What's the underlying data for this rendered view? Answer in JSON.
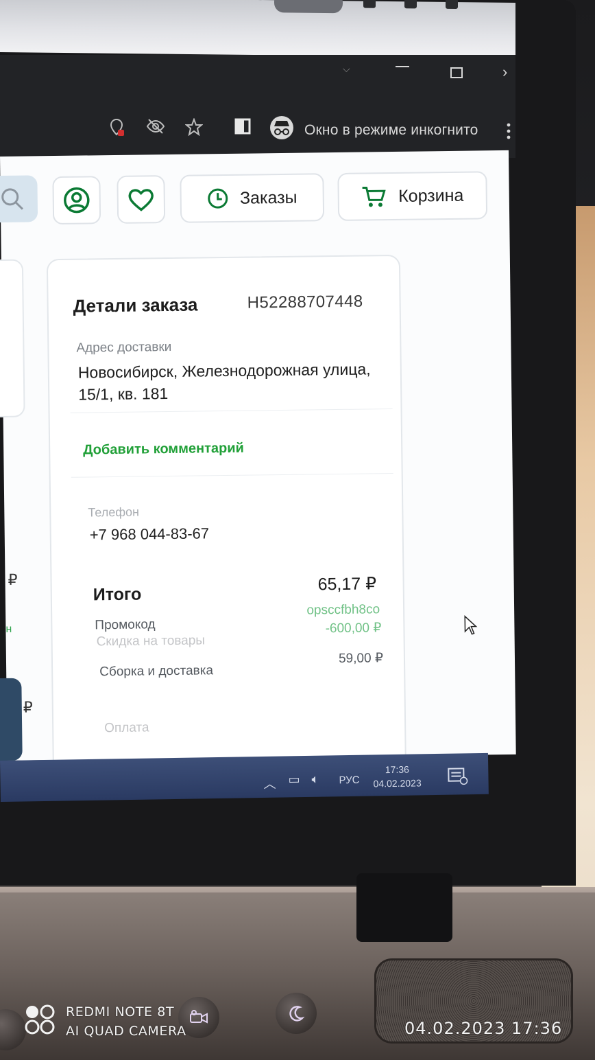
{
  "browser": {
    "incognito_label": "Окно в режиме инкогнито"
  },
  "header": {
    "orders_label": "Заказы",
    "cart_label": "Корзина"
  },
  "order": {
    "title": "Детали заказа",
    "number": "H52288707448",
    "address_label": "Адрес доставки",
    "address": "Новосибирск, Железнодорожная улица, 15/1, кв. 181",
    "add_comment_label": "Добавить комментарий",
    "phone_label": "Телефон",
    "phone": "+7 968 044-83-67",
    "total_label": "Итого",
    "total_value": "65,17 ₽",
    "promo_label": "Промокод",
    "promo_code": "opsccfbh8co",
    "discount_label": "Скидка на товары",
    "discount_value": "-600,00 ₽",
    "delivery_label": "Сборка и доставка",
    "delivery_value": "59,00 ₽",
    "payment_label": "Оплата"
  },
  "left_panel": {
    "currency_1": "₽",
    "green_fragment": "н",
    "currency_2": "₽"
  },
  "taskbar": {
    "language": "РУС",
    "time": "17:36",
    "date": "04.02.2023"
  },
  "camera_watermark": {
    "model": "REDMI NOTE 8T",
    "camera": "AI QUAD CAMERA",
    "datetime": "04.02.2023 17:36"
  },
  "colors": {
    "accent_green": "#21a038",
    "icon_green": "#0b7a34",
    "taskbar_blue": "#2f406a"
  },
  "icons": [
    "search-icon",
    "profile-icon",
    "heart-icon",
    "clock-icon",
    "cart-icon",
    "incognito-icon",
    "star-icon",
    "eye-off-icon",
    "location-icon"
  ]
}
